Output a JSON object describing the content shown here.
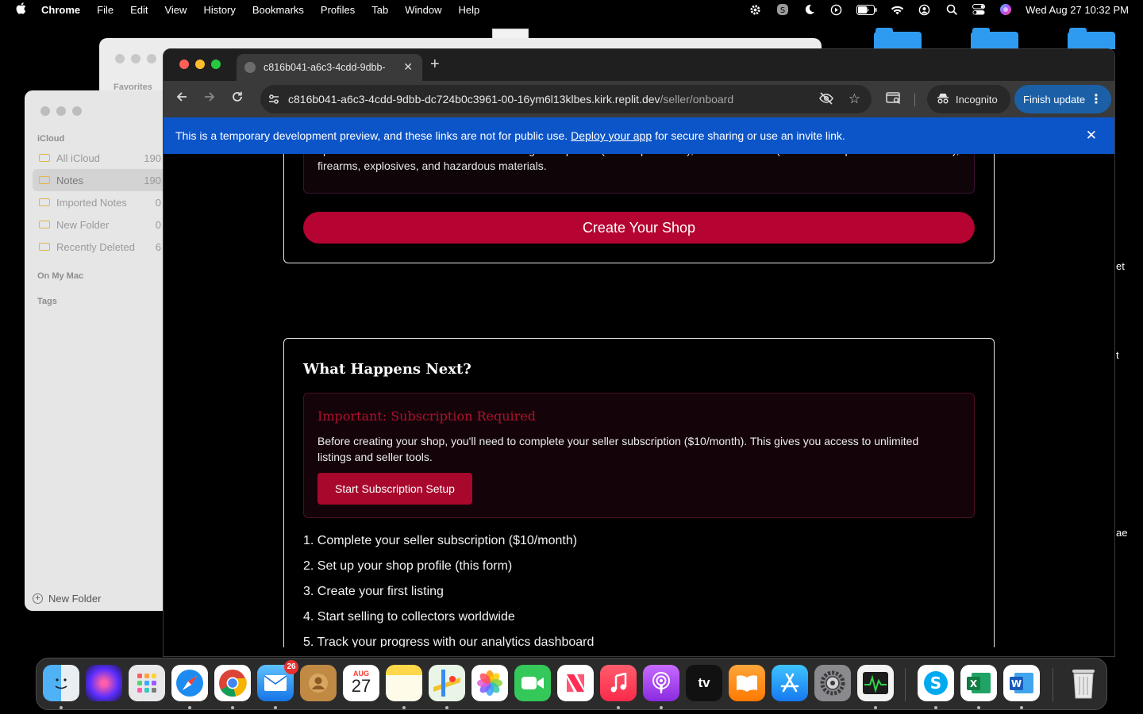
{
  "menubar": {
    "app_name": "Chrome",
    "items": [
      "File",
      "Edit",
      "View",
      "History",
      "Bookmarks",
      "Profiles",
      "Tab",
      "Window",
      "Help"
    ],
    "clock": "Wed Aug 27  10:32 PM"
  },
  "finder_window": {
    "sidebar_heading": "Favorites"
  },
  "desktop": {
    "side_text_1": "et",
    "side_text_2": "t",
    "side_text_3": "ae"
  },
  "notes": {
    "section_icloud": "iCloud",
    "folders": [
      {
        "label": "All iCloud",
        "count": "190"
      },
      {
        "label": "Notes",
        "count": "190"
      },
      {
        "label": "Imported Notes",
        "count": "0"
      },
      {
        "label": "New Folder",
        "count": "0"
      },
      {
        "label": "Recently Deleted",
        "count": "6"
      }
    ],
    "section_mac": "On My Mac",
    "section_tags": "Tags",
    "new_folder_label": "New Folder"
  },
  "browser": {
    "tab_title": "c816b041-a6c3-4cdd-9dbb-",
    "url_host": "c816b041-a6c3-4cdd-9dbb-dc724b0c3961-00-16ym6l13klbes.kirk.replit.dev",
    "url_path": "/seller/onboard",
    "incognito_label": "Incognito",
    "finish_update_label": "Finish update"
  },
  "banner": {
    "text_before": "This is a temporary development preview, and these links are not for public use.",
    "link": "Deploy your app",
    "text_after": "for secure sharing or use an invite link."
  },
  "page": {
    "prohibited_text": "specimens. Prohibited items include endangered species (CITES protected), human remains (with the exception of hair and teeth), firearms, explosives, and hazardous materials.",
    "create_shop_label": "Create Your Shop",
    "next_heading": "What Happens Next?",
    "important_title": "Important: Subscription Required",
    "important_text": "Before creating your shop, you'll need to complete your seller subscription ($10/month). This gives you access to unlimited listings and seller tools.",
    "subscription_button": "Start Subscription Setup",
    "steps": [
      "1. Complete your seller subscription ($10/month)",
      "2. Set up your shop profile (this form)",
      "3. Create your first listing",
      "4. Start selling to collectors worldwide",
      "5. Track your progress with our analytics dashboard"
    ]
  },
  "dock": {
    "calendar_month": "AUG",
    "calendar_day": "27",
    "mail_badge": "26",
    "tv_label": "tv",
    "skype_letter": "S",
    "excel_letter": "X",
    "word_letter": "W"
  },
  "colors": {
    "accent_red": "#b50431",
    "banner_blue": "#0c55c9",
    "update_blue": "#1b5fa6"
  }
}
